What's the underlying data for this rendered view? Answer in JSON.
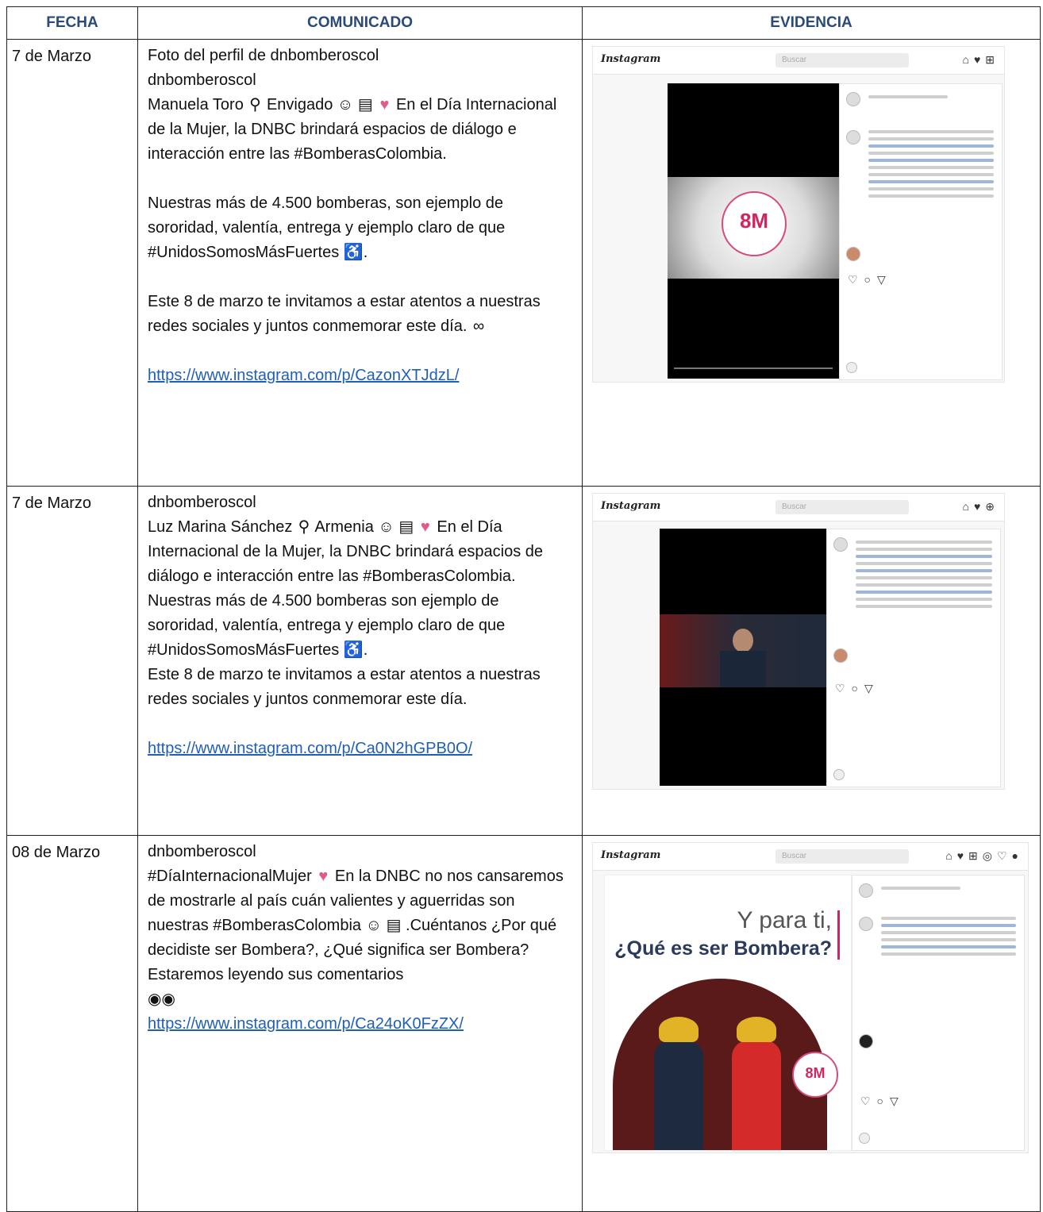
{
  "headers": {
    "fecha": "FECHA",
    "comunicado": "COMUNICADO",
    "evidencia": "EVIDENCIA"
  },
  "rows": [
    {
      "date": "7 de Marzo",
      "lines": [
        "Foto del perfil de dnbomberoscol",
        "dnbomberoscol",
        "Manuela Toro",
        "Envigado",
        "En el Día Internacional de la Mujer, la DNBC brindará espacios de diálogo e interacción entre las #BomberasColombia.",
        "Nuestras más de 4.500 bomberas, son ejemplo de sororidad, valentía, entrega y ejemplo claro de que #UnidosSomosMásFuertes",
        "Este 8 de marzo te invitamos a estar atentos a nuestras redes sociales y juntos conmemorar este día."
      ],
      "link": "https://www.instagram.com/p/CazonXTJdzL/",
      "evidence": {
        "brand": "Instagram",
        "search": "Buscar",
        "badge": "8M"
      }
    },
    {
      "date": "7 de Marzo",
      "lines": [
        "dnbomberoscol",
        "Luz Marina Sánchez",
        "Armenia",
        "En el Día Internacional de la Mujer, la DNBC brindará espacios de diálogo e interacción entre las #BomberasColombia. Nuestras más de 4.500 bomberas son ejemplo de sororidad, valentía, entrega y ejemplo claro de que #UnidosSomosMásFuertes",
        "Este 8 de marzo te invitamos a estar atentos a nuestras redes sociales y juntos conmemorar este día."
      ],
      "link": "https://www.instagram.com/p/Ca0N2hGPB0O/",
      "evidence": {
        "brand": "Instagram",
        "search": "Buscar"
      }
    },
    {
      "date": "08 de Marzo",
      "lines": [
        "dnbomberoscol",
        "#DíaInternacionalMujer",
        "En la DNBC no nos cansaremos de mostrarle al país cuán valientes y aguerridas son nuestras #BomberasColombia",
        ".Cuéntanos ¿Por qué decidiste ser Bombera?, ¿Qué significa ser Bombera? Estaremos leyendo sus comentarios"
      ],
      "link": "https://www.instagram.com/p/Ca24oK0FzZX/",
      "evidence": {
        "brand": "Instagram",
        "search": "Buscar",
        "poster_line1": "Y para ti,",
        "poster_line2": "¿Qué es ser Bombera?",
        "badge": "8M"
      }
    }
  ],
  "icons": {
    "pin": "pin-icon",
    "woman": "woman-icon",
    "firetruck": "fire-truck-icon",
    "heart": "heart-icon",
    "wheelchair": "wheelchair-icon",
    "hands": "open-hands-icon",
    "eyes": "eyes-icon"
  },
  "colors": {
    "header": "#2a4a78",
    "link": "#1f5fb8",
    "brand_pink": "#d4245e"
  }
}
